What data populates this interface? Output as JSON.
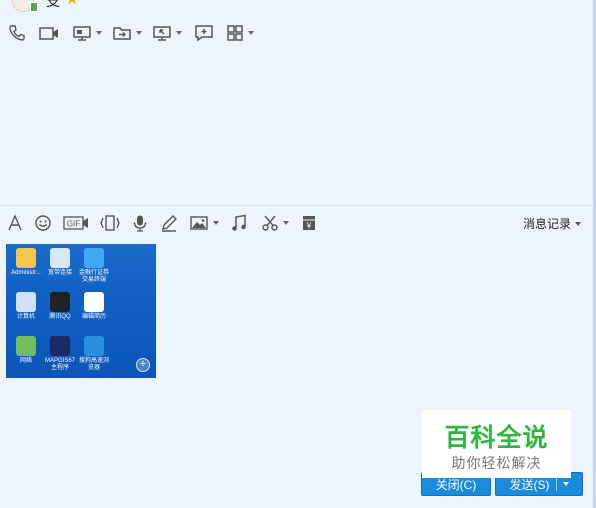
{
  "header": {
    "contact_name": "支",
    "star": "★"
  },
  "top_toolbar": {
    "items": [
      "phone-icon",
      "video-call-icon",
      "screen-share-icon",
      "file-transfer-icon",
      "remote-assist-icon",
      "new-chat-icon",
      "apps-grid-icon"
    ]
  },
  "input_toolbar": {
    "items": [
      "font-icon",
      "emoji-icon",
      "gif-icon",
      "shake-icon",
      "voice-icon",
      "handwrite-icon",
      "image-icon",
      "music-icon",
      "screenshot-icon",
      "red-packet-icon"
    ],
    "gif_label": "GIF",
    "history_label": "消息记录",
    "red_packet_symbol": "¥"
  },
  "screenshot_thumbnail": {
    "desktop_icons": [
      {
        "label": "Administr...",
        "color": "#f2c94c"
      },
      {
        "label": "宽带连接",
        "color": "#d8e8f5"
      },
      {
        "label": "金融行证券\n交易终端",
        "color": "#3fa9f5"
      },
      {
        "label": "计算机",
        "color": "#cfe3f5"
      },
      {
        "label": "腾讯QQ",
        "color": "#222222"
      },
      {
        "label": "编辑简历",
        "color": "#ffffff"
      },
      {
        "label": "网络",
        "color": "#6fbf5f"
      },
      {
        "label": "MAPGIS67\n主程序",
        "color": "#1b2b66"
      },
      {
        "label": "搜狗高速浏\n览器",
        "color": "#2b8fe0"
      }
    ],
    "zoom_symbol": "+"
  },
  "footer": {
    "close_label": "关闭(C)",
    "send_label": "发送(S)"
  },
  "watermark": {
    "title": "百科全说",
    "subtitle": "助你轻松解决"
  },
  "colors": {
    "accent": "#1a8ce0",
    "background": "#eef4fb",
    "watermark_green": "#2fb540"
  }
}
